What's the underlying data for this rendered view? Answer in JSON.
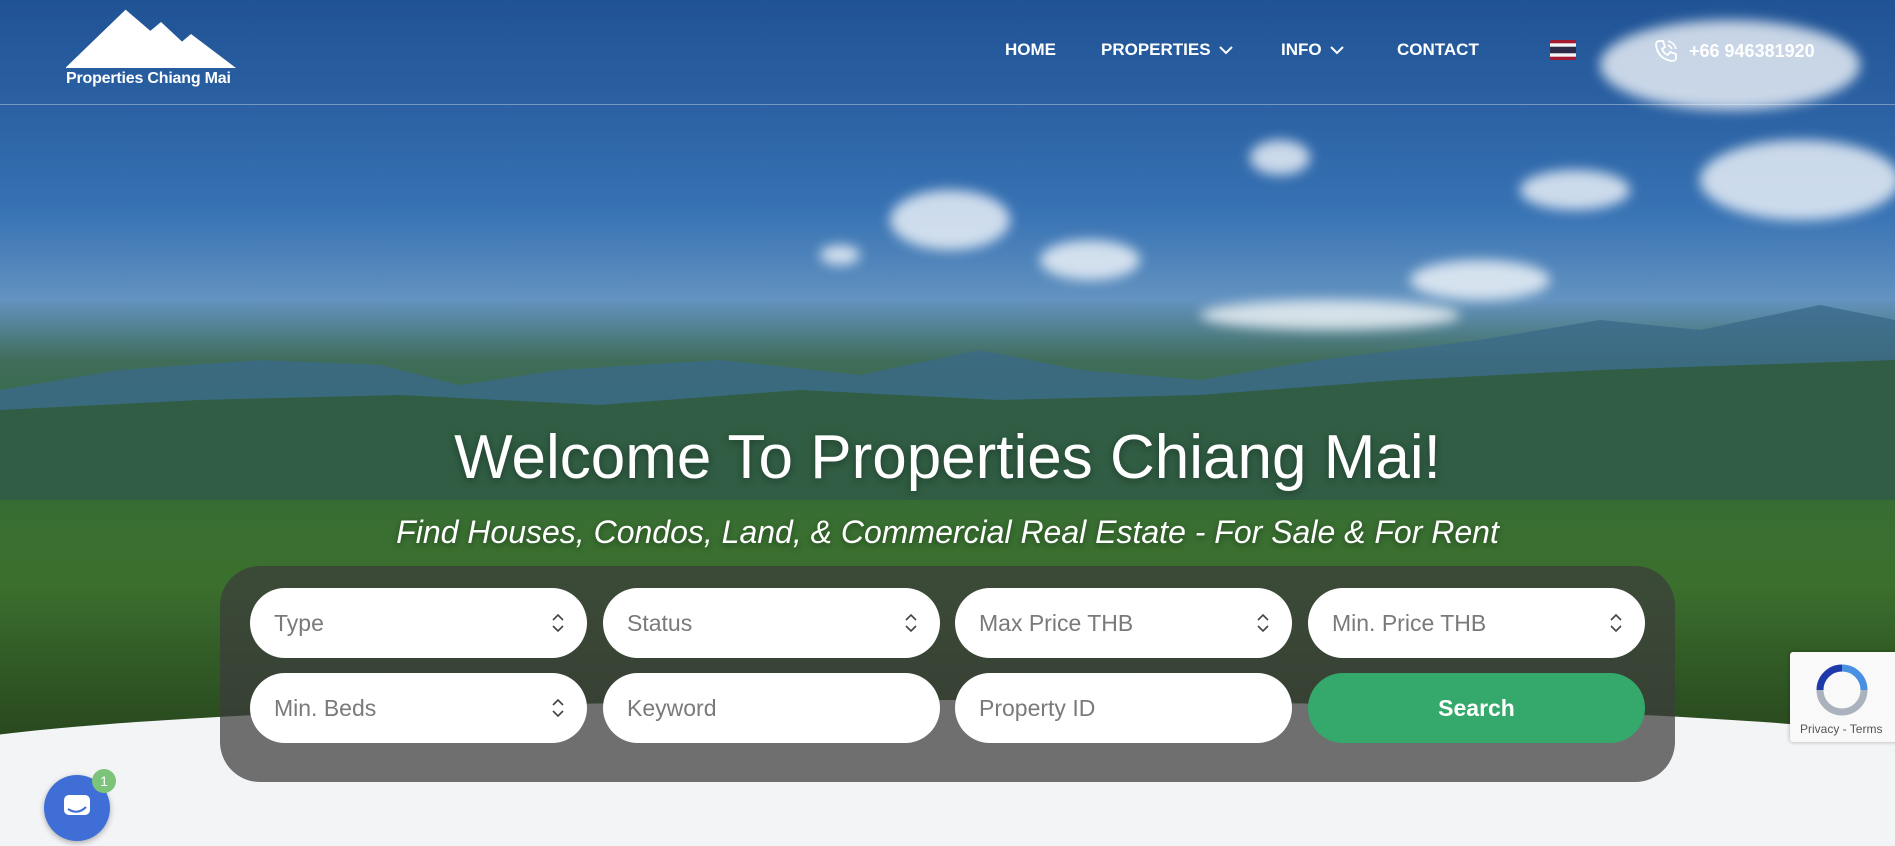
{
  "brand": {
    "name": "Properties Chiang Mai"
  },
  "nav": {
    "home": "HOME",
    "properties": "PROPERTIES",
    "info": "INFO",
    "contact": "CONTACT",
    "phone": "+66 946381920"
  },
  "hero": {
    "title": "Welcome To Properties Chiang Mai!",
    "subtitle": "Find Houses, Condos, Land, & Commercial Real Estate - For Sale & For Rent"
  },
  "search": {
    "type": "Type",
    "status": "Status",
    "max_price": "Max Price THB",
    "min_price": "Min. Price THB",
    "min_beds": "Min. Beds",
    "keyword_placeholder": "Keyword",
    "property_id_placeholder": "Property ID",
    "button": "Search"
  },
  "recaptcha": {
    "links": "Privacy - Terms"
  },
  "chat": {
    "badge": "1"
  },
  "colors": {
    "accent": "#35a86b",
    "chat": "#3f6fd6",
    "badge": "#7bc47a"
  }
}
